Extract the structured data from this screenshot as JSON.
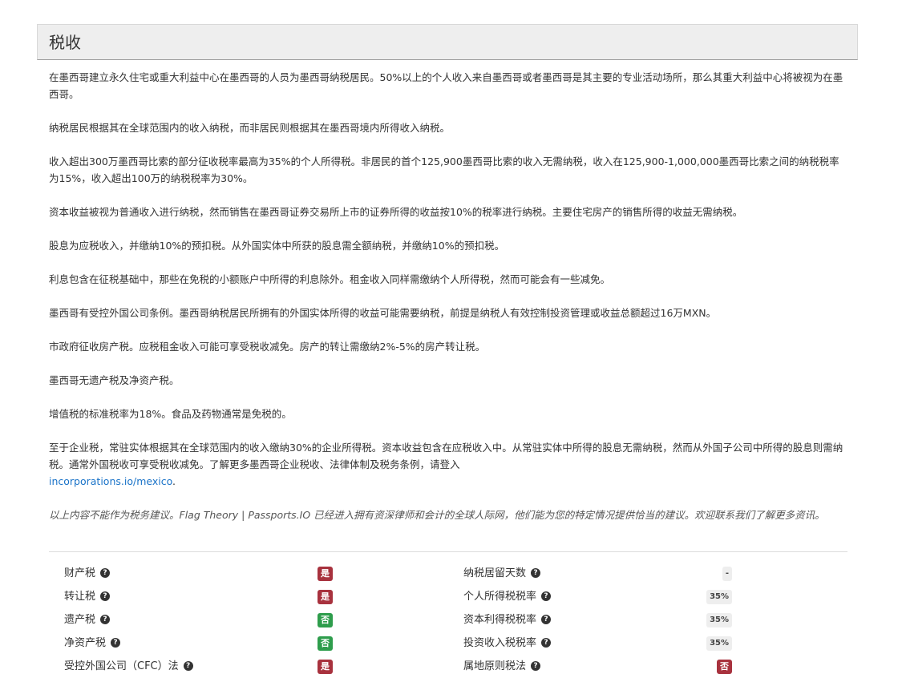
{
  "header": {
    "title": "税收"
  },
  "content": {
    "paragraphs": [
      "在墨西哥建立永久住宅或重大利益中心在墨西哥的人员为墨西哥纳税居民。50%以上的个人收入来自墨西哥或者墨西哥是其主要的专业活动场所，那么其重大利益中心将被视为在墨西哥。",
      "纳税居民根据其在全球范围内的收入纳税，而非居民则根据其在墨西哥境内所得收入纳税。",
      "收入超出300万墨西哥比索的部分征收税率最高为35%的个人所得税。非居民的首个125,900墨西哥比索的收入无需纳税，收入在125,900-1,000,000墨西哥比索之间的纳税税率为15%，收入超出100万的纳税税率为30%。",
      "资本收益被视为普通收入进行纳税，然而销售在墨西哥证券交易所上市的证券所得的收益按10%的税率进行纳税。主要住宅房产的销售所得的收益无需纳税。",
      "股息为应税收入，并缴纳10%的预扣税。从外国实体中所获的股息需全额纳税，并缴纳10%的预扣税。",
      "利息包含在征税基础中，那些在免税的小额账户中所得的利息除外。租金收入同样需缴纳个人所得税，然而可能会有一些减免。",
      "墨西哥有受控外国公司条例。墨西哥纳税居民所拥有的外国实体所得的收益可能需要纳税，前提是纳税人有效控制投资管理或收益总额超过16万MXN。",
      "市政府征收房产税。应税租金收入可能可享受税收减免。房产的转让需缴纳2%-5%的房产转让税。",
      "墨西哥无遗产税及净资产税。",
      "增值税的标准税率为18%。食品及药物通常是免税的。"
    ],
    "corporate_text": "至于企业税，常驻实体根据其在全球范围内的收入缴纳30%的企业所得税。资本收益包含在应税收入中。从常驻实体中所得的股息无需纳税，然而从外国子公司中所得的股息则需纳税。通常外国税收可享受税收减免。了解更多墨西哥企业税收、法律体制及税务条例，请登入",
    "corporate_link": "incorporations.io/mexico",
    "corporate_tail": ".",
    "disclaimer": "以上内容不能作为税务建议。Flag Theory | Passports.IO 已经进入拥有资深律师和会计的全球人际网，他们能为您的特定情况提供恰当的建议。欢迎联系我们了解更多资讯。"
  },
  "summary": {
    "left": [
      {
        "label": "财产税",
        "value": "是",
        "status": "red"
      },
      {
        "label": "转让税",
        "value": "是",
        "status": "red"
      },
      {
        "label": "遗产税",
        "value": "否",
        "status": "green"
      },
      {
        "label": "净资产税",
        "value": "否",
        "status": "green"
      },
      {
        "label": "受控外国公司（CFC）法",
        "value": "是",
        "status": "red"
      }
    ],
    "right": [
      {
        "label": "纳税居留天数",
        "value": "-",
        "status": "gray"
      },
      {
        "label": "个人所得税税率",
        "value": "35%",
        "status": "gray"
      },
      {
        "label": "资本利得税税率",
        "value": "35%",
        "status": "gray"
      },
      {
        "label": "投资收入税税率",
        "value": "35%",
        "status": "gray"
      },
      {
        "label": "属地原则税法",
        "value": "否",
        "status": "red"
      }
    ],
    "help_icon_glyph": "?"
  },
  "colors": {
    "red": "#a8323e",
    "green": "#2e9d4c",
    "link": "#1a73c8"
  }
}
